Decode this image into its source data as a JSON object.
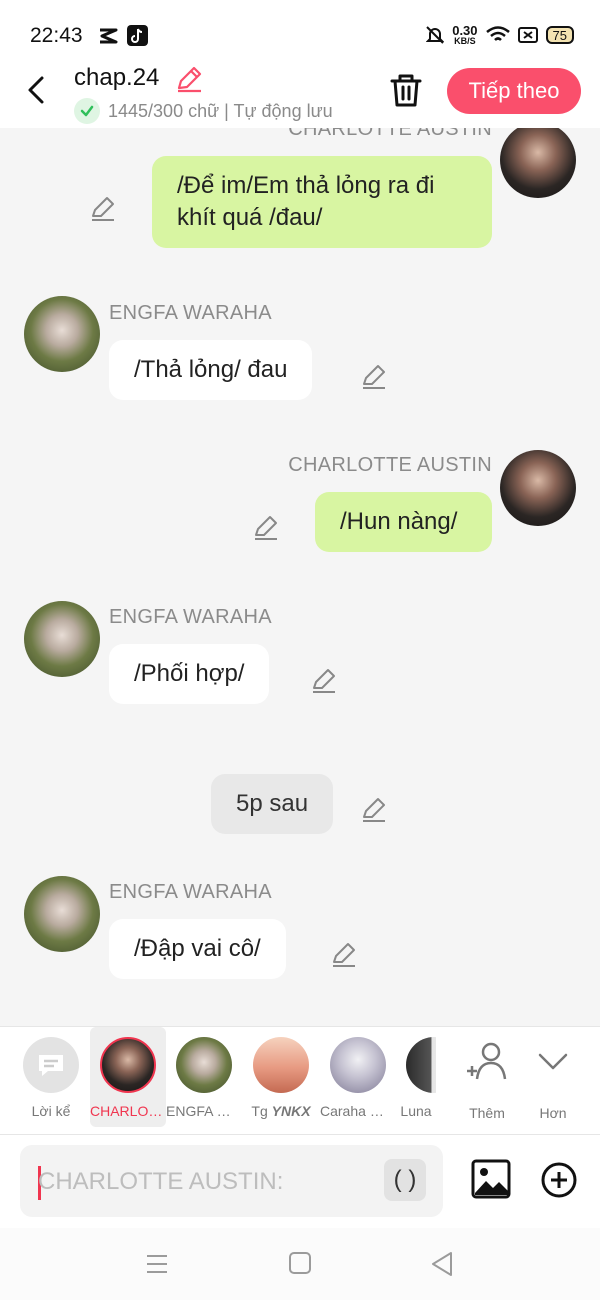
{
  "status_bar": {
    "time": "22:43",
    "net_speed_value": "0.30",
    "net_speed_unit": "KB/S",
    "battery": "75",
    "icons": [
      "capcut-icon",
      "tiktok-icon",
      "mute-bell-icon",
      "wifi-icon",
      "sim-icon",
      "battery-icon"
    ]
  },
  "header": {
    "title": "chap.24",
    "subtitle": "1445/300 chữ | Tự động lưu",
    "next_label": "Tiếp theo",
    "accent_color": "#fa4f6c"
  },
  "messages": [
    {
      "speaker": "CHARLOTTE AUSTIN",
      "side": "right",
      "lines": [
        "/Để im/Em thả lỏng ra đi",
        "khít quá /đau/"
      ]
    },
    {
      "speaker": "ENGFA WARAHA",
      "side": "left",
      "lines": [
        "/Thả lỏng/ đau"
      ]
    },
    {
      "speaker": "CHARLOTTE AUSTIN",
      "side": "right",
      "lines": [
        "/Hun nàng/"
      ]
    },
    {
      "speaker": "ENGFA WARAHA",
      "side": "left",
      "lines": [
        "/Phối hợp/"
      ]
    },
    {
      "speaker": "",
      "side": "center",
      "lines": [
        "5p sau"
      ]
    },
    {
      "speaker": "ENGFA WARAHA",
      "side": "left",
      "lines": [
        "/Đập vai cô/"
      ]
    }
  ],
  "characters": [
    {
      "label": "Lời kể",
      "selected": false
    },
    {
      "label": "CHARLOTTE AUSTIN",
      "selected": true
    },
    {
      "label": "ENGFA WARAHA",
      "selected": false
    },
    {
      "label_prefix": "Tg ",
      "label_emph": "YNKX",
      "selected": false
    },
    {
      "label": "Caraha Wi...",
      "selected": false
    },
    {
      "label": "Luna",
      "selected": false
    }
  ],
  "picker_actions": {
    "more": "Thêm",
    "expand": "Hơn"
  },
  "input": {
    "placeholder": "CHARLOTTE AUSTIN:",
    "paren_label": "( )"
  },
  "colors": {
    "my_bubble": "#d8f5a2",
    "other_bubble": "#ffffff",
    "selected": "#f0354f"
  }
}
